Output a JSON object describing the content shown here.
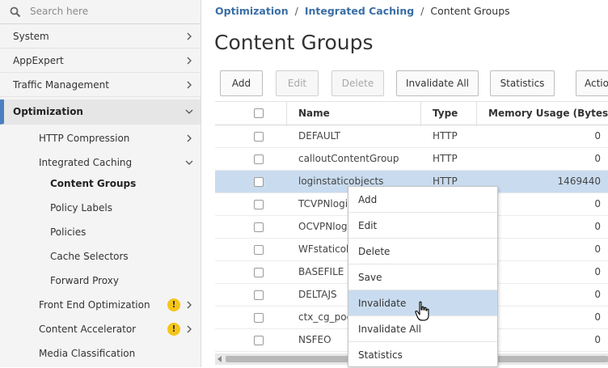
{
  "search": {
    "placeholder": "Search here"
  },
  "sidebar": {
    "items": [
      {
        "label": "System"
      },
      {
        "label": "AppExpert"
      },
      {
        "label": "Traffic Management"
      },
      {
        "label": "Optimization"
      }
    ],
    "optimization_children": [
      {
        "label": "HTTP Compression"
      },
      {
        "label": "Integrated Caching"
      }
    ],
    "integrated_caching_children": [
      {
        "label": "Content Groups"
      },
      {
        "label": "Policy Labels"
      },
      {
        "label": "Policies"
      },
      {
        "label": "Cache Selectors"
      },
      {
        "label": "Forward Proxy"
      }
    ],
    "more_children": [
      {
        "label": "Front End Optimization",
        "warning": "!"
      },
      {
        "label": "Content Accelerator",
        "warning": "!"
      },
      {
        "label": "Media Classification"
      }
    ]
  },
  "breadcrumb": {
    "items": [
      "Optimization",
      "Integrated Caching"
    ],
    "current": "Content Groups",
    "separator": "/"
  },
  "page": {
    "title": "Content Groups"
  },
  "toolbar": {
    "add": "Add",
    "edit": "Edit",
    "delete": "Delete",
    "invalidate_all": "Invalidate All",
    "statistics": "Statistics",
    "action": "Actio"
  },
  "table": {
    "headers": {
      "name": "Name",
      "type": "Type",
      "memory": "Memory Usage (Bytes)"
    },
    "rows": [
      {
        "name": "DEFAULT",
        "type": "HTTP",
        "memory": "0"
      },
      {
        "name": "calloutContentGroup",
        "type": "HTTP",
        "memory": "0"
      },
      {
        "name": "loginstaticobjects",
        "type": "HTTP",
        "memory": "1469440"
      },
      {
        "name": "TCVPNlogin",
        "type": "",
        "memory": "0"
      },
      {
        "name": "OCVPNlogi",
        "type": "",
        "memory": "0"
      },
      {
        "name": "WFstaticob",
        "type": "",
        "memory": "0"
      },
      {
        "name": "BASEFILE",
        "type": "",
        "memory": "0"
      },
      {
        "name": "DELTAJS",
        "type": "",
        "memory": "0"
      },
      {
        "name": "ctx_cg_poc",
        "type": "",
        "memory": "0"
      },
      {
        "name": "NSFEO",
        "type": "",
        "memory": "0"
      }
    ]
  },
  "context_menu": {
    "items": [
      "Add",
      "Edit",
      "Delete",
      "Save",
      "Invalidate",
      "Invalidate All",
      "Statistics"
    ],
    "hovered": "Invalidate"
  },
  "colors": {
    "accent": "#4a7fc1",
    "selected_row": "#c9dcef",
    "link": "#3a6ea5",
    "warning": "#f5c518"
  }
}
